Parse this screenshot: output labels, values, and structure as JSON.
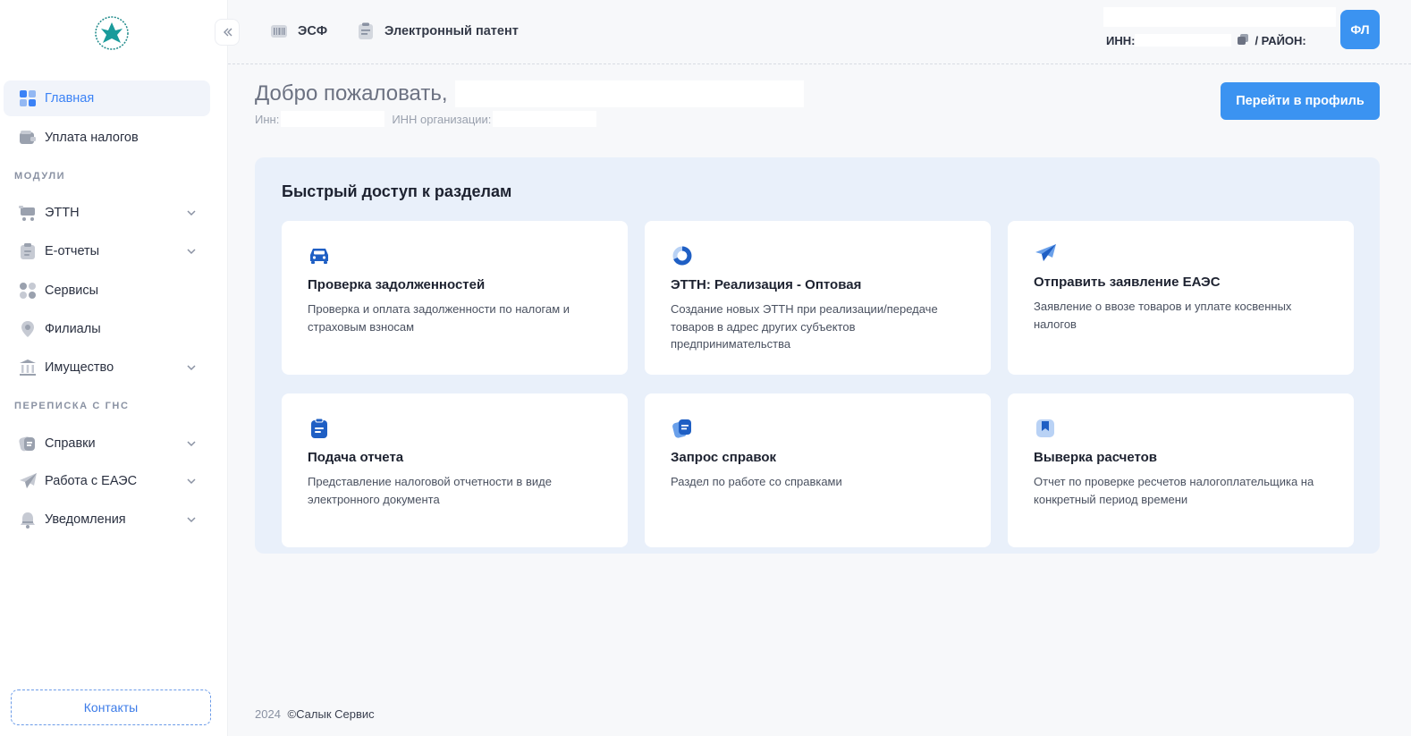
{
  "sidebar": {
    "items": [
      {
        "label": "Главная"
      },
      {
        "label": "Уплата налогов"
      },
      {
        "label": "ЭТТН"
      },
      {
        "label": "Е-отчеты"
      },
      {
        "label": "Сервисы"
      },
      {
        "label": "Филиалы"
      },
      {
        "label": "Имущество"
      },
      {
        "label": "Справки"
      },
      {
        "label": "Работа с ЕАЭС"
      },
      {
        "label": "Уведомления"
      }
    ],
    "sections": {
      "modules": "МОДУЛИ",
      "correspondence": "ПЕРЕПИСКА С ГНС"
    },
    "contacts": "Контакты"
  },
  "topbar": {
    "links": [
      {
        "label": "ЭСФ"
      },
      {
        "label": "Электронный патент"
      }
    ],
    "inn_label": "ИНН:",
    "district_label": "/ РАЙОН:",
    "badge": "ФЛ"
  },
  "welcome": {
    "greeting": "Добро пожаловать,",
    "inn_label": "Инн:",
    "org_inn_label": "ИНН организации:",
    "profile_button": "Перейти в профиль"
  },
  "quick_access": {
    "title": "Быстрый доступ к разделам",
    "cards": [
      {
        "icon": "car-icon",
        "title": "Проверка задолженностей",
        "desc": "Проверка и оплата задолженности по налогам и страховым взносам"
      },
      {
        "icon": "donut-icon",
        "title": "ЭТТН: Реализация - Оптовая",
        "desc": "Создание новых ЭТТН при реализации/передаче товаров в адрес других субъектов предпринимательства"
      },
      {
        "icon": "plane-icon",
        "title": "Отправить заявление ЕАЭС",
        "desc": "Заявление о ввозе товаров и уплате косвенных налогов"
      },
      {
        "icon": "clipboard-icon",
        "title": "Подача отчета",
        "desc": "Представление налоговой отчетности в виде электронного документа"
      },
      {
        "icon": "documents-icon",
        "title": "Запрос справок",
        "desc": "Раздел по работе со справками"
      },
      {
        "icon": "bookmark-icon",
        "title": "Выверка расчетов",
        "desc": "Отчет по проверке ресчетов налогоплательщика на конкретный период времени"
      }
    ]
  },
  "footer": {
    "year": "2024",
    "copyright": "©Салык Сервис"
  },
  "colors": {
    "accent": "#3b93f1",
    "panel": "#e9f0fa",
    "icon_blue": "#1f5fc4"
  }
}
